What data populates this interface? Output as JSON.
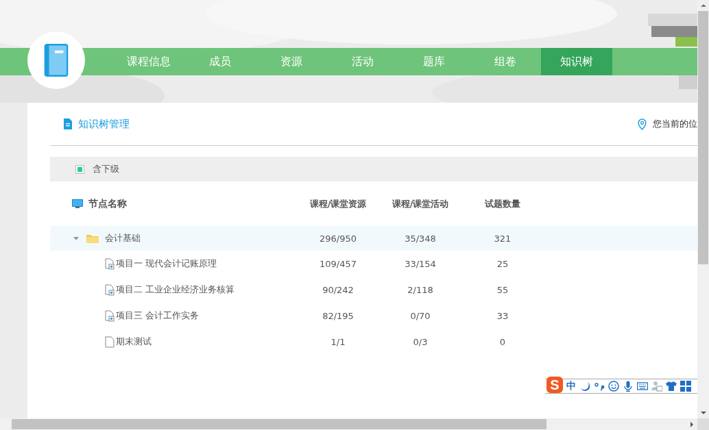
{
  "nav": {
    "items": [
      {
        "label": "课程信息",
        "selected": false
      },
      {
        "label": "成员",
        "selected": false
      },
      {
        "label": "资源",
        "selected": false
      },
      {
        "label": "活动",
        "selected": false
      },
      {
        "label": "题库",
        "selected": false
      },
      {
        "label": "组卷",
        "selected": false
      },
      {
        "label": "知识树",
        "selected": true
      }
    ]
  },
  "panel": {
    "title": "知识树管理",
    "location": "您当前的位"
  },
  "filter": {
    "label": "含下级",
    "checked": true
  },
  "tree": {
    "columns": [
      "节点名称",
      "课程/课堂资源",
      "课程/课堂活动",
      "试题数量"
    ],
    "nodes": [
      {
        "kind": "folder",
        "name": "会计基础",
        "resources": "296/950",
        "activities": "35/348",
        "questions": "321",
        "expanded": true,
        "selected": true,
        "children": [
          {
            "kind": "doc-plus",
            "name": "项目一 现代会计记账原理",
            "resources": "109/457",
            "activities": "33/154",
            "questions": "25",
            "selected": false
          },
          {
            "kind": "doc-plus",
            "name": "项目二 工业企业经济业务核算",
            "resources": "90/242",
            "activities": "2/118",
            "questions": "55",
            "selected": false
          },
          {
            "kind": "doc-plus",
            "name": "项目三 会计工作实务",
            "resources": "82/195",
            "activities": "0/70",
            "questions": "33",
            "selected": false
          },
          {
            "kind": "doc",
            "name": "期末测试",
            "resources": "1/1",
            "activities": "0/3",
            "questions": "0",
            "selected": false
          }
        ]
      }
    ]
  },
  "ime_toolbar": {
    "logo": "S",
    "mode": "中"
  }
}
